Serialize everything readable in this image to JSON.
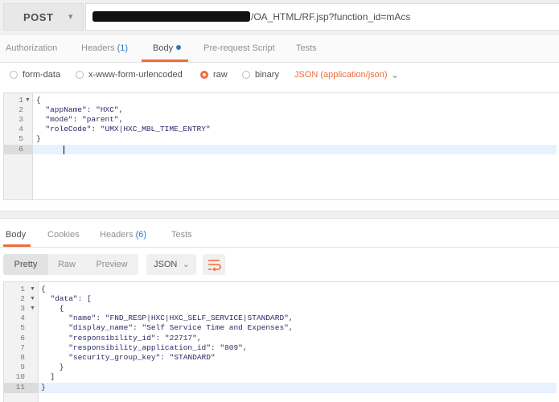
{
  "request": {
    "method": "POST",
    "url_visible": "/OA_HTML/RF.jsp?function_id=mAcs"
  },
  "request_tabs": [
    {
      "label": "Authorization",
      "count": null
    },
    {
      "label": "Headers",
      "count": "(1)"
    },
    {
      "label": "Body",
      "count": null,
      "active": true
    },
    {
      "label": "Pre-request Script",
      "count": null
    },
    {
      "label": "Tests",
      "count": null
    }
  ],
  "body_types": [
    {
      "label": "form-data",
      "selected": false
    },
    {
      "label": "x-www-form-urlencoded",
      "selected": false
    },
    {
      "label": "raw",
      "selected": true
    },
    {
      "label": "binary",
      "selected": false
    }
  ],
  "content_type": "JSON (application/json)",
  "request_body": {
    "lines": [
      {
        "n": "1",
        "fold": true,
        "text": "{"
      },
      {
        "n": "2",
        "fold": false,
        "text": "  \"appName\": \"HXC\","
      },
      {
        "n": "3",
        "fold": false,
        "text": "  \"mode\": \"parent\","
      },
      {
        "n": "4",
        "fold": false,
        "text": "  \"roleCode\": \"UMX|HXC_MBL_TIME_ENTRY\""
      },
      {
        "n": "5",
        "fold": false,
        "text": "}"
      },
      {
        "n": "6",
        "fold": false,
        "text": ""
      }
    ]
  },
  "response_tabs": [
    {
      "label": "Body",
      "count": null,
      "active": true
    },
    {
      "label": "Cookies",
      "count": null
    },
    {
      "label": "Headers",
      "count": "(6)"
    },
    {
      "label": "Tests",
      "count": null
    }
  ],
  "response_toolbar": {
    "views": [
      "Pretty",
      "Raw",
      "Preview"
    ],
    "active_view": "Pretty",
    "format": "JSON",
    "wrap_icon": "wrap-lines-icon"
  },
  "response_body": {
    "lines": [
      {
        "n": "1",
        "fold": true,
        "text": "{"
      },
      {
        "n": "2",
        "fold": true,
        "text": "  \"data\": ["
      },
      {
        "n": "3",
        "fold": true,
        "text": "    {"
      },
      {
        "n": "4",
        "fold": false,
        "text": "      \"name\": \"FND_RESP|HXC|HXC_SELF_SERVICE|STANDARD\","
      },
      {
        "n": "5",
        "fold": false,
        "text": "      \"display_name\": \"Self Service Time and Expenses\","
      },
      {
        "n": "6",
        "fold": false,
        "text": "      \"responsibility_id\": \"22717\","
      },
      {
        "n": "7",
        "fold": false,
        "text": "      \"responsibility_application_id\": \"809\","
      },
      {
        "n": "8",
        "fold": false,
        "text": "      \"security_group_key\": \"STANDARD\""
      },
      {
        "n": "9",
        "fold": false,
        "text": "    }"
      },
      {
        "n": "10",
        "fold": false,
        "text": "  ]"
      },
      {
        "n": "11",
        "fold": false,
        "text": "}"
      }
    ]
  },
  "colors": {
    "accent": "#f26b3a",
    "link": "#2a7ac0"
  }
}
